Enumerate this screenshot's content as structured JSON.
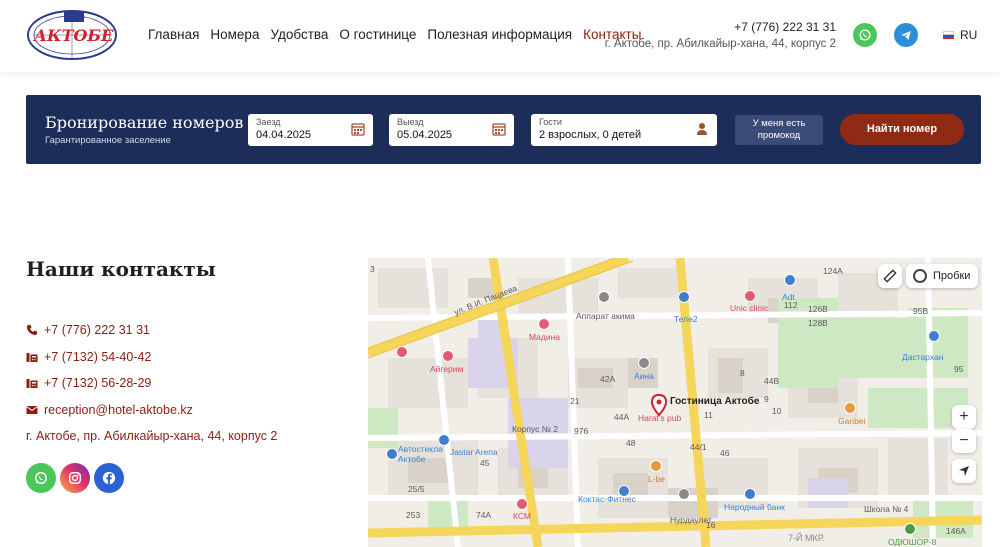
{
  "header": {
    "logo_text": "АКТОБЕ",
    "nav": [
      "Главная",
      "Номера",
      "Удобства",
      "О гостинице",
      "Полезная информация",
      "Контакты"
    ],
    "active_nav": "Контакты",
    "phone": "+7 (776) 222 31 31",
    "address": "г. Актобе, пр. Абилкайыр-хана, 44, корпус 2",
    "lang": "RU"
  },
  "booking": {
    "title": "Бронирование номеров",
    "subtitle": "Гарантированное заселение",
    "checkin_label": "Заезд",
    "checkin_value": "04.04.2025",
    "checkout_label": "Выезд",
    "checkout_value": "05.04.2025",
    "guests_label": "Гости",
    "guests_value": "2 взрослых, 0 детей",
    "promo_label": "У меня есть промокод",
    "find_label": "Найти номер"
  },
  "contacts": {
    "title": "Наши контакты",
    "mobile": "+7 (776) 222 31 31",
    "phone1": "+7 (7132) 54-40-42",
    "phone2": "+7 (7132) 56-28-29",
    "email": "reception@hotel-aktobe.kz",
    "address": "г. Актобе, пр. Абилкайыр-хана, 44, корпус 2"
  },
  "map": {
    "traffic_label": "Пробки",
    "hotel_label": "Гостиница Актобе",
    "zoom_in": "+",
    "zoom_out": "−",
    "labels": {
      "street": "ул. В.И. Пацаева",
      "apparat": "Аппарат акима",
      "tele2": "Теле2",
      "unic": "Unic clinic",
      "adt": "Adt",
      "madina": "Мадина",
      "aigerim": "Айгерим",
      "aina": "Аина",
      "harats": "Harat's pub",
      "korpus": "Корпус № 2",
      "avtosteklo": "Автостекла Актобе",
      "jastar": "Jastar Arena",
      "libe": "L-be",
      "koktas": "Коктас-Фитнес",
      "ksm": "КСМ",
      "nurdaulet": "Нурдаулет",
      "bank": "Народный банк",
      "dastarhan": "Дастархан",
      "ganbei": "Ganbei",
      "school": "Школа № 4",
      "oduyshor": "ОДЮШОР-8",
      "mkr": "7-Й МКР."
    },
    "numbers": [
      "3",
      "124А",
      "112",
      "95В",
      "95",
      "42А",
      "44А",
      "44В",
      "44/1",
      "46",
      "48",
      "16",
      "25/5",
      "45",
      "74А",
      "253",
      "146А",
      "126В",
      "128В",
      "10",
      "11",
      "8",
      "9",
      "976",
      "21"
    ]
  }
}
